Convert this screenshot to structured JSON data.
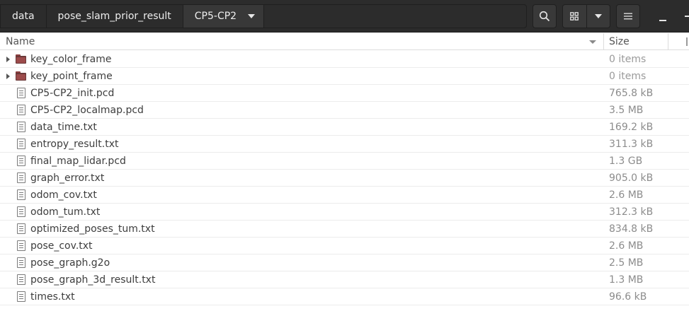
{
  "breadcrumbs": [
    "data",
    "pose_slam_prior_result",
    "CP5-CP2"
  ],
  "columns": {
    "name": "Name",
    "size": "Size"
  },
  "files": [
    {
      "type": "folder",
      "name": "key_color_frame",
      "size": "0 items"
    },
    {
      "type": "folder",
      "name": "key_point_frame",
      "size": "0 items"
    },
    {
      "type": "file",
      "name": "CP5-CP2_init.pcd",
      "size": "765.8 kB"
    },
    {
      "type": "file",
      "name": "CP5-CP2_localmap.pcd",
      "size": "3.5 MB"
    },
    {
      "type": "file",
      "name": "data_time.txt",
      "size": "169.2 kB"
    },
    {
      "type": "file",
      "name": "entropy_result.txt",
      "size": "311.3 kB"
    },
    {
      "type": "file",
      "name": "final_map_lidar.pcd",
      "size": "1.3 GB"
    },
    {
      "type": "file",
      "name": "graph_error.txt",
      "size": "905.0 kB"
    },
    {
      "type": "file",
      "name": "odom_cov.txt",
      "size": "2.6 MB"
    },
    {
      "type": "file",
      "name": "odom_tum.txt",
      "size": "312.3 kB"
    },
    {
      "type": "file",
      "name": "optimized_poses_tum.txt",
      "size": "834.8 kB"
    },
    {
      "type": "file",
      "name": "pose_cov.txt",
      "size": "2.6 MB"
    },
    {
      "type": "file",
      "name": "pose_graph.g2o",
      "size": "2.5 MB"
    },
    {
      "type": "file",
      "name": "pose_graph_3d_result.txt",
      "size": "1.3 MB"
    },
    {
      "type": "file",
      "name": "times.txt",
      "size": "96.6 kB"
    }
  ],
  "colors": {
    "headerbar": "#2c2c2c",
    "folder": "#9c4b4b",
    "size_text": "#8c8c8c"
  }
}
